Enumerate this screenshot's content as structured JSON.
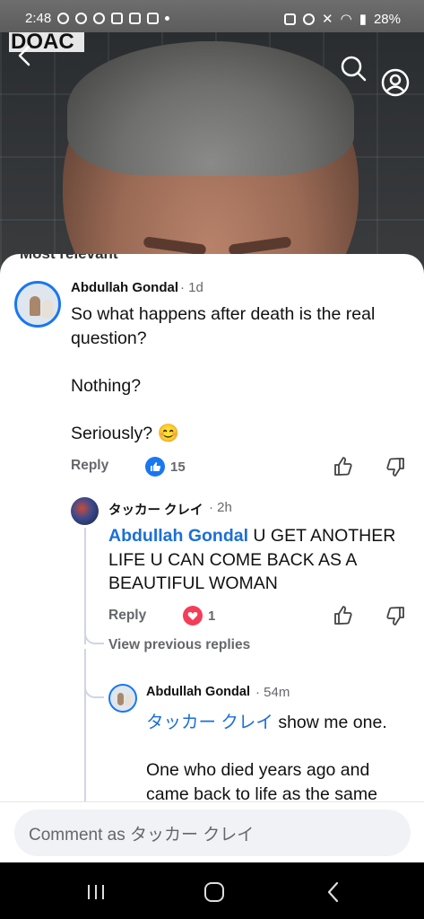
{
  "status_bar": {
    "time": "2:48",
    "battery": "28%"
  },
  "video": {
    "logo_text": "DOAC"
  },
  "comments": {
    "sort_label": "Most relevant",
    "main": {
      "author": "Abdullah Gondal",
      "time": "· 1d",
      "text": "So what happens after death is the real question?\n\nNothing?\n\nSeriously? 😊",
      "reply_label": "Reply",
      "like_count": "15"
    },
    "reply1": {
      "author": "タッカー クレイ",
      "time": "· 2h",
      "mention": "Abdullah Gondal",
      "text": " U GET ANOTHER LIFE U CAN COME BACK AS A BEAUTIFUL WOMAN",
      "reply_label": "Reply",
      "love_count": "1"
    },
    "view_previous": "View previous replies",
    "reply2": {
      "author": "Abdullah Gondal",
      "time": "· 54m",
      "mention": "タッカー クレイ",
      "text": " show me one.\n\nOne who died years ago and came back to life as the same"
    }
  },
  "composer": {
    "placeholder": "Comment as タッカー クレイ"
  },
  "colors": {
    "accent": "#1877f2",
    "love": "#f33e58",
    "mention": "#1b6fd6"
  }
}
